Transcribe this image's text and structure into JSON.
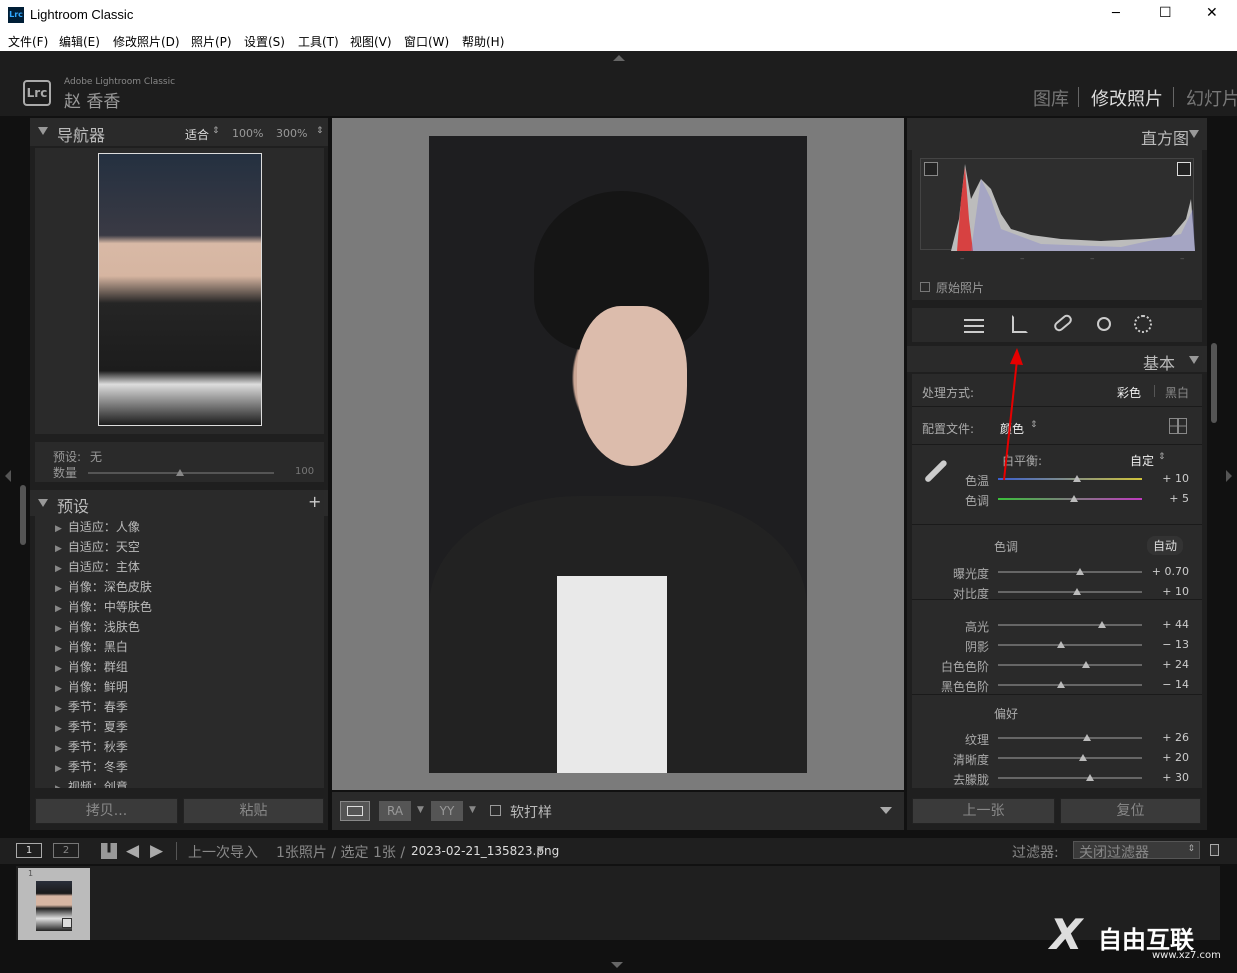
{
  "window": {
    "title": "Lightroom Classic",
    "logo": "Lrc",
    "minimize": "─",
    "maximize": "☐",
    "close": "✕"
  },
  "menu": [
    "文件(F)",
    "编辑(E)",
    "修改照片(D)",
    "照片(P)",
    "设置(S)",
    "工具(T)",
    "视图(V)",
    "窗口(W)",
    "帮助(H)"
  ],
  "identity": {
    "app_logo": "Lrc",
    "app_name": "Adobe Lightroom Classic",
    "user": "赵 香香"
  },
  "modules": [
    "图库",
    "修改照片",
    "幻灯片"
  ],
  "navigator": {
    "title": "导航器",
    "fit": "适合",
    "zoom1": "100%",
    "zoom2": "300%"
  },
  "preset_info": {
    "preset_label": "预设:",
    "preset_value": "无",
    "amount_label": "数量",
    "amount_value": "100"
  },
  "presets": {
    "title": "预设",
    "add": "+",
    "items": [
      "自适应：人像",
      "自适应：天空",
      "自适应：主体",
      "肖像：深色皮肤",
      "肖像：中等肤色",
      "肖像：浅肤色",
      "肖像：黑白",
      "肖像：群组",
      "肖像：鲜明",
      "季节：春季",
      "季节：夏季",
      "季节：秋季",
      "季节：冬季",
      "视频：创意"
    ]
  },
  "left_buttons": {
    "copy": "拷贝...",
    "paste": "粘贴"
  },
  "toolbar": {
    "soft_proof": "软打样"
  },
  "histogram": {
    "title": "直方图",
    "original": "原始照片"
  },
  "basic": {
    "title": "基本",
    "treatment_label": "处理方式:",
    "color": "彩色",
    "bw": "黑白",
    "profile_label": "配置文件:",
    "profile_value": "颜色",
    "wb_label": "白平衡:",
    "wb_value": "自定",
    "tone_label": "色调",
    "auto": "自动",
    "presence_label": "偏好"
  },
  "sliders": [
    {
      "label": "色温",
      "value": "+ 10",
      "pos": 0.55
    },
    {
      "label": "色调",
      "value": "+ 5",
      "pos": 0.53
    },
    {
      "label": "曝光度",
      "value": "+ 0.70",
      "pos": 0.57
    },
    {
      "label": "对比度",
      "value": "+ 10",
      "pos": 0.55
    },
    {
      "label": "高光",
      "value": "+ 44",
      "pos": 0.72
    },
    {
      "label": "阴影",
      "value": "− 13",
      "pos": 0.44
    },
    {
      "label": "白色色阶",
      "value": "+ 24",
      "pos": 0.61
    },
    {
      "label": "黑色色阶",
      "value": "− 14",
      "pos": 0.44
    },
    {
      "label": "纹理",
      "value": "+ 26",
      "pos": 0.62
    },
    {
      "label": "清晰度",
      "value": "+ 20",
      "pos": 0.59
    },
    {
      "label": "去朦胧",
      "value": "+ 30",
      "pos": 0.64
    }
  ],
  "right_buttons": {
    "prev": "上一张",
    "reset": "复位"
  },
  "filmstrip": {
    "page1": "1",
    "page2": "2",
    "source": "上一次导入",
    "count": "1张照片 / 选定 1张 /",
    "filename": "2023-02-21_135823.png",
    "filter_label": "过滤器:",
    "filter_value": "关闭过滤器",
    "thumb_index": "1"
  },
  "watermark": {
    "text": "自由互联",
    "url": "www.xz7.com"
  },
  "colors": {
    "accent": "#e60000",
    "panel": "#2a2a2a",
    "bg": "#111111"
  }
}
